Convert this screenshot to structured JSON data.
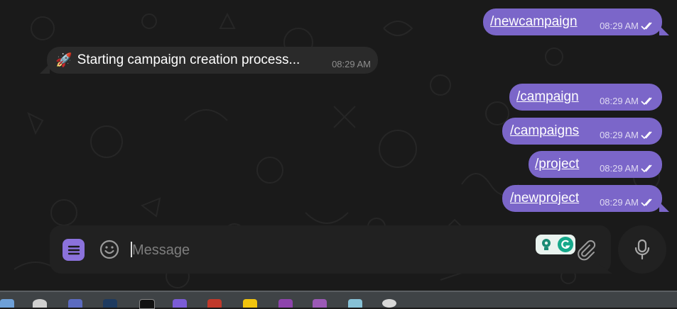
{
  "chat": {
    "messages": [
      {
        "id": "m1",
        "direction": "outgoing",
        "text": "/newcampaign",
        "time": "08:29 AM",
        "status": "read"
      },
      {
        "id": "m2",
        "direction": "incoming",
        "emoji": "🚀",
        "text": "Starting campaign creation process...",
        "time": "08:29 AM"
      },
      {
        "id": "m3",
        "direction": "outgoing",
        "text": "/campaign",
        "time": "08:29 AM",
        "status": "read"
      },
      {
        "id": "m4",
        "direction": "outgoing",
        "text": "/campaigns",
        "time": "08:29 AM",
        "status": "read"
      },
      {
        "id": "m5",
        "direction": "outgoing",
        "text": "/project",
        "time": "08:29 AM",
        "status": "read"
      },
      {
        "id": "m6",
        "direction": "outgoing",
        "text": "/newproject",
        "time": "08:29 AM",
        "status": "read"
      }
    ]
  },
  "composer": {
    "placeholder": "Message",
    "value": "",
    "menu_icon": "menu-lines-icon",
    "emoji_icon": "smiley-icon",
    "attach_icon": "paperclip-icon",
    "mic_icon": "microphone-icon",
    "extensions": [
      "bulb-extension-icon",
      "grammarly-icon"
    ]
  },
  "taskbar": {
    "icons": [
      "app-icon-1",
      "app-icon-2",
      "app-icon-3",
      "steam-icon",
      "x-icon",
      "app-icon-6",
      "app-icon-7",
      "app-icon-8",
      "app-icon-9",
      "app-icon-10",
      "app-icon-11",
      "settings-gear-icon"
    ]
  },
  "colors": {
    "outgoing_bubble": "#7b66c9",
    "incoming_bubble": "#2a2a2a",
    "composer": "#212121",
    "menu_button": "#8b72dc",
    "background": "#1a1a1a"
  }
}
